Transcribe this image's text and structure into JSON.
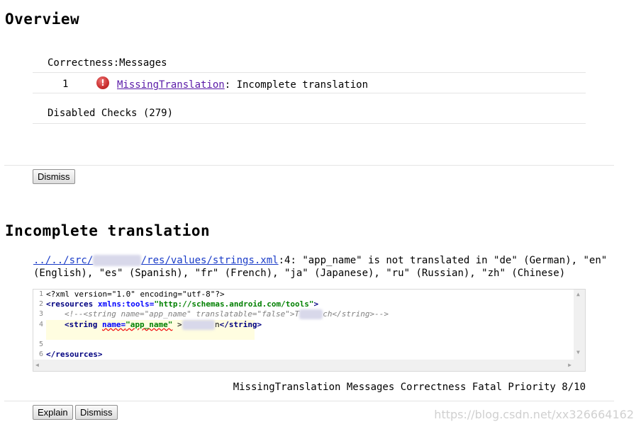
{
  "overview": {
    "title": "Overview",
    "category": "Correctness:Messages",
    "issue_count": "1",
    "issue_link": "MissingTranslation",
    "issue_text": ": Incomplete translation",
    "disabled_checks": "Disabled Checks (279)",
    "dismiss_label": "Dismiss"
  },
  "detail": {
    "title": "Incomplete translation",
    "path_prefix": "../../src/",
    "path_suffix": "/res/values/strings.xml",
    "location_text": ":4: \"app_name\" is not translated in \"de\" (German), \"en\"",
    "location_text_2": "(English), \"es\" (Spanish), \"fr\" (French), \"ja\" (Japanese), \"ru\" (Russian), \"zh\" (Chinese)",
    "meta": "MissingTranslation Messages Correctness Fatal Priority 8/10",
    "explain_label": "Explain",
    "dismiss_label": "Dismiss"
  },
  "code": {
    "line_numbers": [
      "1",
      "2",
      "3",
      "4",
      "5",
      "6"
    ],
    "l1": "<?xml version=\"1.0\" encoding=\"utf-8\"?>",
    "l2_tag": "<resources",
    "l2_attr": "xmlns:tools=",
    "l2_val": "\"http://schemas.android.com/tools\"",
    "l2_close": ">",
    "l3_comment_a": "<!--<string name=\"app_name\" translatable=\"false\">T",
    "l3_comment_b": "ch</string>-->",
    "l4_open": "<string",
    "l4_attr": "name=",
    "l4_val": "\"app_name\"",
    "l4_gt": " >",
    "l4_end": "n",
    "l4_close": "</string>",
    "l6": "</resources>"
  },
  "watermark": "https://blog.csdn.net/xx326664162",
  "colors": {
    "error_red": "#cc3333",
    "link_purple": "#5a1aa8",
    "xml_green": "#008000"
  }
}
